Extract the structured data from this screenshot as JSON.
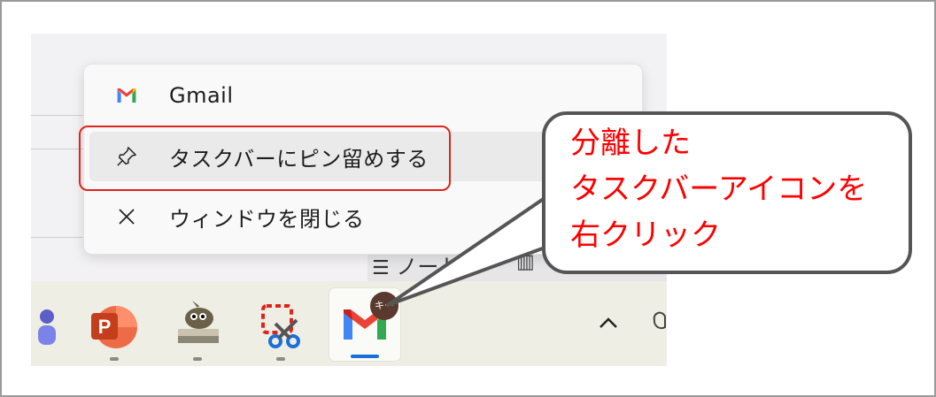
{
  "context_menu": {
    "items": [
      {
        "label": "Gmail",
        "icon": "gmail-icon"
      },
      {
        "label": "タスクバーにピン留めする",
        "icon": "pin-icon"
      },
      {
        "label": "ウィンドウを閉じる",
        "icon": "close-icon"
      }
    ]
  },
  "callout": {
    "lines": [
      "分離した",
      "タスクバーアイコンを",
      "右クリック"
    ]
  },
  "background": {
    "partial_label": "ノート"
  },
  "taskbar": {
    "apps": [
      {
        "name": "teams-app-icon"
      },
      {
        "name": "powerpoint-app-icon",
        "letter": "P"
      },
      {
        "name": "gimp-app-icon"
      },
      {
        "name": "snipping-tool-app-icon"
      },
      {
        "name": "gmail-app-icon",
        "letter": "M",
        "badge": "キー"
      }
    ],
    "tray_chevron": "^"
  },
  "colors": {
    "highlight": "#e0241b",
    "callout_text": "#ff0000",
    "callout_border": "#555555",
    "taskbar_active": "#1a6fd8"
  }
}
